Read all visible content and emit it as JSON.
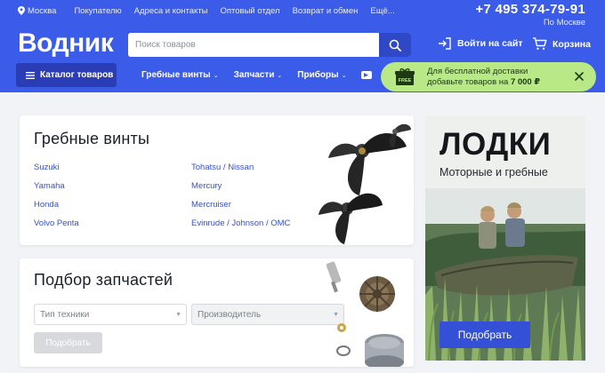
{
  "topbar": {
    "city": "Москва",
    "links": [
      "Покупателю",
      "Адреса и контакты",
      "Оптовый отдел",
      "Возврат и обмен",
      "Ещё..."
    ],
    "phone": "+7 495 374-79-91",
    "phone_note": "По Москве"
  },
  "logo": "Водник",
  "search": {
    "placeholder": "Поиск товаров"
  },
  "account": {
    "login": "Войти на сайт",
    "cart": "Корзина"
  },
  "nav": {
    "catalog": "Каталог товаров",
    "items": [
      "Гребные винты",
      "Запчасти",
      "Приборы"
    ]
  },
  "promo": {
    "badge": "FREE",
    "line1": "Для бесплатной доставки",
    "line2_prefix": "добавьте товаров на ",
    "line2_amount": "7 000 ₽"
  },
  "propellers": {
    "title": "Гребные винты",
    "brands": [
      "Suzuki",
      "Tohatsu / Nissan",
      "Yamaha",
      "Mercury",
      "Honda",
      "Mercruiser",
      "Volvo Penta",
      "Evinrude / Johnson / OMC"
    ]
  },
  "parts": {
    "title": "Подбор запчастей",
    "type_placeholder": "Тип техники",
    "maker_placeholder": "Производитель",
    "button": "Подобрать"
  },
  "banner": {
    "title": "ЛОДКИ",
    "subtitle": "Моторные и гребные",
    "button": "Подобрать"
  },
  "colors": {
    "brand": "#3a5ce8",
    "promo": "#b8e986",
    "link": "#3552c7"
  }
}
